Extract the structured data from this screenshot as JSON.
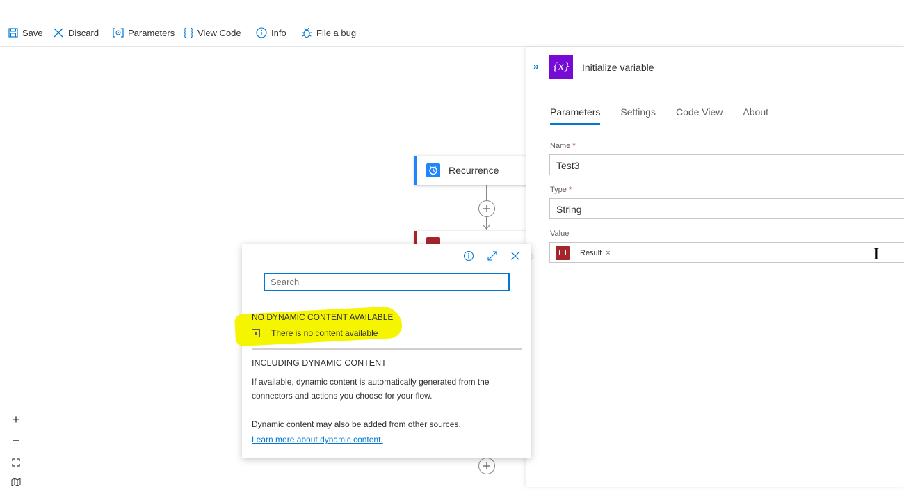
{
  "toolbar": {
    "save": "Save",
    "discard": "Discard",
    "parameters": "Parameters",
    "view_code": "View Code",
    "info": "Info",
    "file_bug": "File a bug"
  },
  "canvas": {
    "recurrence_label": "Recurrence",
    "zoom_in": "+",
    "zoom_out": "−"
  },
  "panel": {
    "title": "Initialize variable",
    "var_icon_text": "{x}",
    "tabs": [
      {
        "label": "Parameters",
        "active": true
      },
      {
        "label": "Settings",
        "active": false
      },
      {
        "label": "Code View",
        "active": false
      },
      {
        "label": "About",
        "active": false
      }
    ],
    "name_label": "Name",
    "name_value": "Test3",
    "type_label": "Type",
    "type_value": "String",
    "value_label": "Value",
    "value_token": "Result",
    "required_mark": "*",
    "token_remove": "×"
  },
  "popup": {
    "search_placeholder": "Search",
    "no_dynamic_title": "NO DYNAMIC CONTENT AVAILABLE",
    "no_dynamic_text": "There is no content available",
    "including_title": "INCLUDING DYNAMIC CONTENT",
    "including_text": "If available, dynamic content is automatically generated from the connectors and actions you choose for your flow.",
    "other_sources_text": "Dynamic content may also be added from other sources.",
    "learn_more": "Learn more about dynamic content."
  },
  "colors": {
    "accent": "#0078d4",
    "variable_icon": "#770bd6",
    "recurrence_icon": "#1f85ff",
    "token_icon": "#a4262c",
    "highlight": "#f5f500"
  }
}
